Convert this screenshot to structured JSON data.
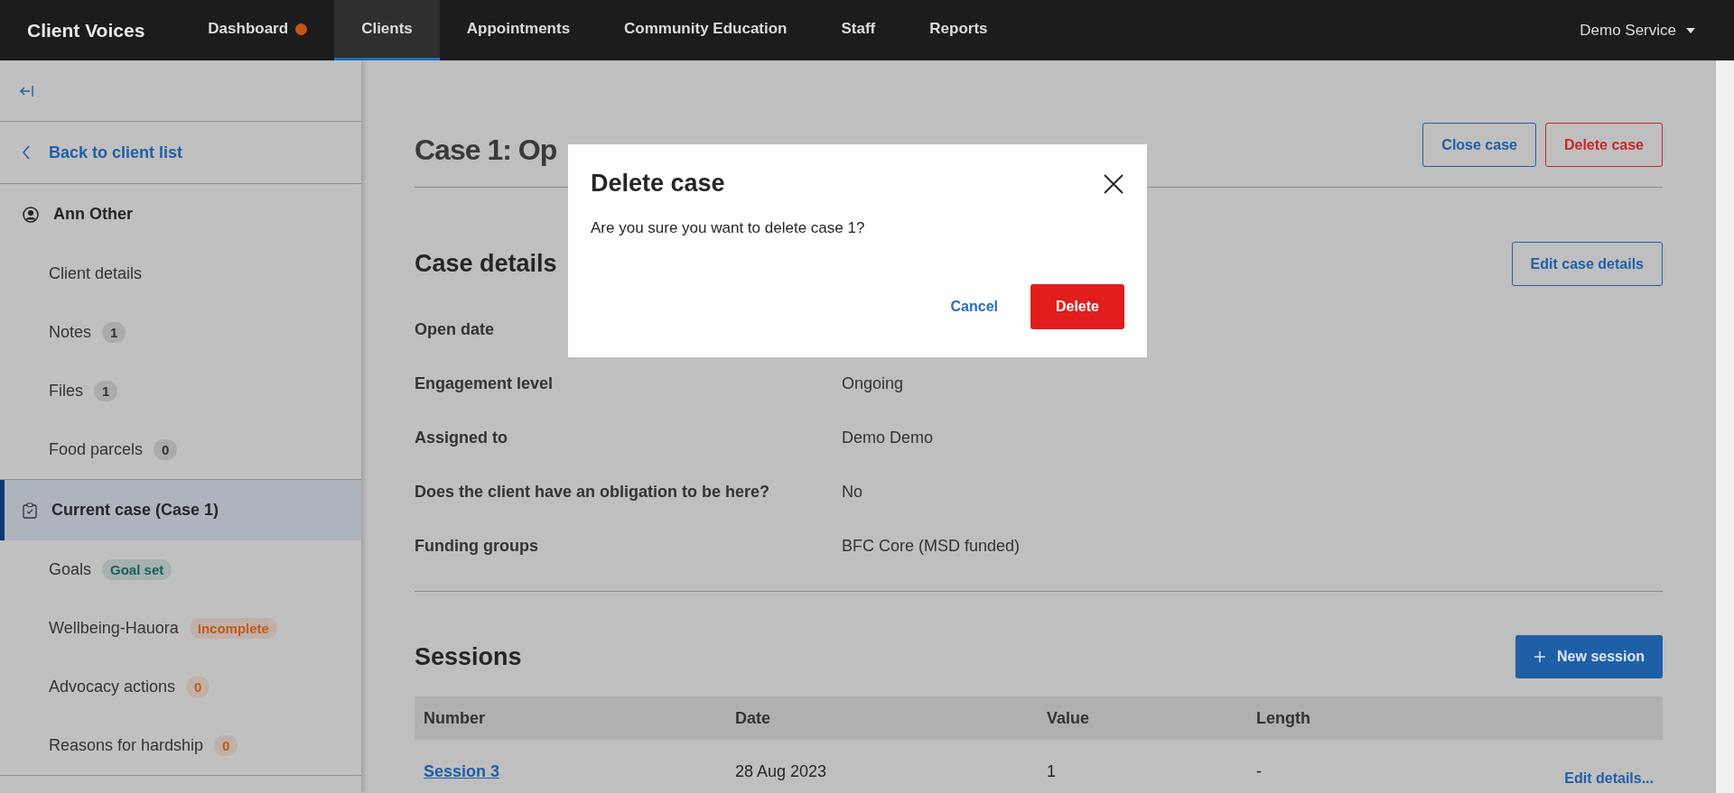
{
  "navbar": {
    "brand": "Client Voices",
    "items": [
      {
        "label": "Dashboard",
        "selected": false,
        "color": "#c8541a"
      },
      {
        "label": "Clients",
        "selected": true
      },
      {
        "label": "Appointments",
        "selected": false
      },
      {
        "label": "Community Education",
        "selected": false
      },
      {
        "label": "Staff",
        "selected": false
      },
      {
        "label": "Reports",
        "selected": false
      }
    ],
    "account": "Demo Service"
  },
  "sidebar": {
    "back_link": "Back to client list",
    "sections": [
      {
        "title": "Ann Other",
        "kind": "client",
        "selected": false,
        "items": [
          {
            "label": "Client details"
          },
          {
            "label": "Notes",
            "badge": "1",
            "color": "#333333"
          },
          {
            "label": "Files",
            "badge": "1",
            "color": "#333333"
          },
          {
            "label": "Food parcels",
            "badge": "0",
            "color": "#333333"
          }
        ]
      },
      {
        "title": "Current case (Case 1)",
        "kind": "case",
        "selected": true,
        "items": [
          {
            "label": "Goals",
            "badge": "Goal set",
            "color": "#17605a"
          },
          {
            "label": "Wellbeing-Hauora",
            "badge": "Incomplete",
            "color": "#c05a1b"
          },
          {
            "label": "Advocacy actions",
            "badge": "0",
            "color": "#c05a1b"
          },
          {
            "label": "Reasons for hardship",
            "badge": "0",
            "color": "#c05a1b"
          }
        ]
      }
    ]
  },
  "case": {
    "title": "Case 1: Op",
    "actions": [
      {
        "label": "Close case",
        "kind": "primary"
      },
      {
        "label": "Delete case",
        "kind": "danger"
      }
    ],
    "details": {
      "title": "Case details",
      "edit_button": "Edit case details",
      "fields": [
        {
          "label": "Open date"
        },
        {
          "label": "Engagement level",
          "value": "Ongoing"
        },
        {
          "label": "Assigned to",
          "value": "Demo Demo"
        },
        {
          "label": "Does the client have an obligation to be here?",
          "value": "No"
        },
        {
          "label": "Funding groups",
          "value": "BFC Core (MSD funded)"
        }
      ]
    },
    "sessions": {
      "title": "Sessions",
      "new_button": "New session",
      "columns": [
        "Number",
        "Date",
        "Value",
        "Length"
      ],
      "rows": [
        {
          "number": "Session 3",
          "date": "28 Aug 2023",
          "value": "1",
          "length": "-",
          "action": "Edit details..."
        }
      ]
    }
  },
  "dialog": {
    "title": "Delete case",
    "message": "Are you sure you want to delete case 1?",
    "cancel": "Cancel",
    "confirm": "Delete"
  }
}
